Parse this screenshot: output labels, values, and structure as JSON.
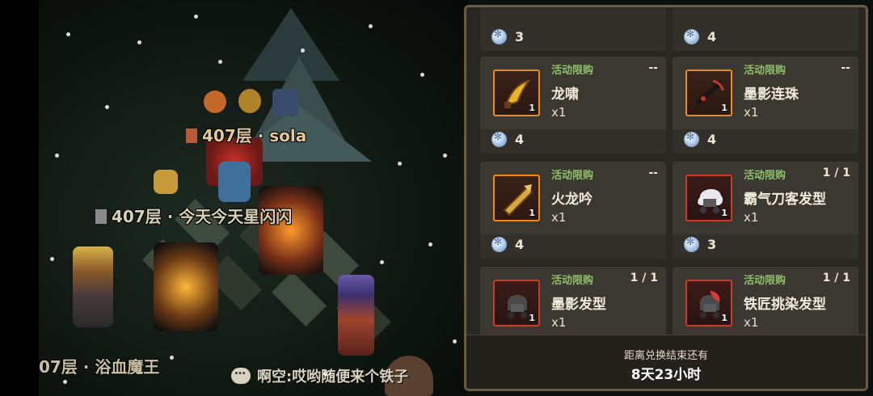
{
  "scene": {
    "players": [
      {
        "label": "407层 · sola"
      },
      {
        "label": "407层 · 今天今天星闪闪"
      },
      {
        "label": "07层 · 浴血魔王"
      }
    ],
    "chat": {
      "text": "啊空:哎哟随便来个铁子"
    }
  },
  "shop": {
    "top_row_prices": [
      "3",
      "4"
    ],
    "items": [
      {
        "name": "龙啸",
        "tag": "活动限购",
        "limit": "--",
        "count": "x1",
        "qty": "1",
        "price": "4",
        "frame": "gold",
        "icon": "golden-blade-icon"
      },
      {
        "name": "墨影连珠",
        "tag": "活动限购",
        "limit": "--",
        "count": "x1",
        "qty": "1",
        "price": "4",
        "frame": "gold",
        "icon": "dark-crossbow-icon"
      },
      {
        "name": "火龙吟",
        "tag": "活动限购",
        "limit": "--",
        "count": "x1",
        "qty": "1",
        "price": "4",
        "frame": "gold",
        "icon": "dragon-cannon-icon"
      },
      {
        "name": "霸气刀客发型",
        "tag": "活动限购",
        "limit": "1 / 1",
        "count": "x1",
        "qty": "1",
        "price": "3",
        "frame": "red",
        "icon": "white-hair-icon"
      },
      {
        "name": "墨影发型",
        "tag": "活动限购",
        "limit": "1 / 1",
        "count": "x1",
        "qty": "1",
        "price": "",
        "frame": "red",
        "icon": "dark-hair-icon"
      },
      {
        "name": "铁匠挑染发型",
        "tag": "活动限购",
        "limit": "1 / 1",
        "count": "x1",
        "qty": "1",
        "price": "",
        "frame": "red",
        "icon": "red-hair-icon"
      }
    ],
    "footer": {
      "label": "距离兑换结束还有",
      "time": "8天23小时"
    }
  }
}
